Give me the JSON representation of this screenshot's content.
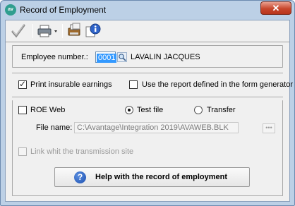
{
  "window": {
    "title": "Record of Employment",
    "app_icon_text": "av",
    "close_label": "✕"
  },
  "toolbar": {
    "items": [
      {
        "name": "checkmark-icon"
      },
      {
        "name": "printer-icon"
      },
      {
        "name": "print-preview-icon"
      },
      {
        "name": "info-icon"
      }
    ]
  },
  "employee": {
    "label": "Employee number.:",
    "number": "0001",
    "name": "LAVALIN JACQUES"
  },
  "options": {
    "print_insurable_label": "Print insurable earnings",
    "print_insurable_checked": true,
    "use_report_label": "Use the report defined in the form generator",
    "use_report_checked": false
  },
  "roe_web": {
    "label": "ROE Web",
    "checked": false,
    "test_file_label": "Test file",
    "transfer_label": "Transfer",
    "selected": "test_file",
    "file_name_label": "File name:",
    "file_name_value": "C:\\Avantage\\Integration 2019\\AVAWEB.BLK",
    "browse_label": "•••",
    "link_label": "Link whit the transmission site"
  },
  "help_button": {
    "label": "Help with the record of employment",
    "icon_text": "?"
  }
}
